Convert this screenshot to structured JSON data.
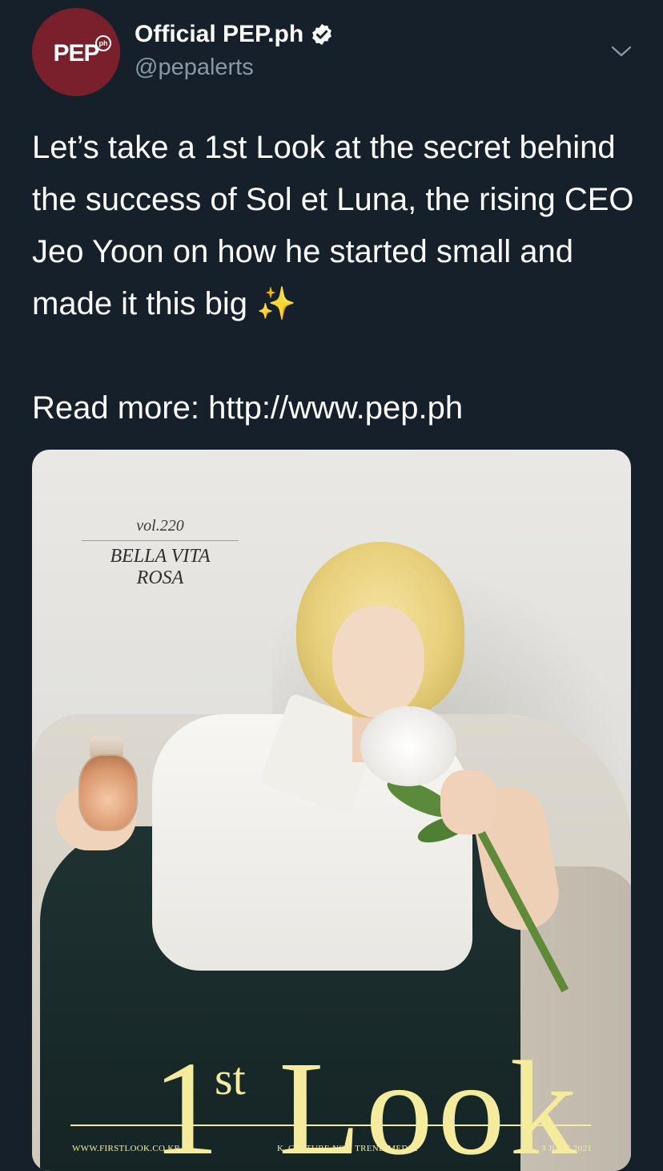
{
  "tweet": {
    "avatar_text": "PEP",
    "avatar_badge": "ph",
    "display_name": "Official PEP.ph",
    "handle": "@pepalerts",
    "verified": true,
    "text": "Let’s take a 1st Look at the secret behind the success of Sol et Luna, the rising CEO Jeo Yoon on how he started small and made it this big ✨\n\nRead more: http://www.pep.ph"
  },
  "media": {
    "cover_vol": "vol.220",
    "cover_title_line1": "BELLA VITA",
    "cover_title_line2": "ROSA",
    "logo_main": "1",
    "logo_sup": "st",
    "logo_word": "Look",
    "footer_left": "WWW.FIRSTLOOK.CO.KR",
    "footer_center": "K_CULTURE NO.1 TREND MEDIA",
    "footer_right": "3 JUNE 2021"
  },
  "colors": {
    "background": "#15202b",
    "secondary_text": "#8899a6",
    "avatar_bg": "#7a1f2c",
    "logo_yellow": "#f4ec9c"
  },
  "icons": [
    "verified-badge-icon",
    "chevron-down-icon"
  ]
}
